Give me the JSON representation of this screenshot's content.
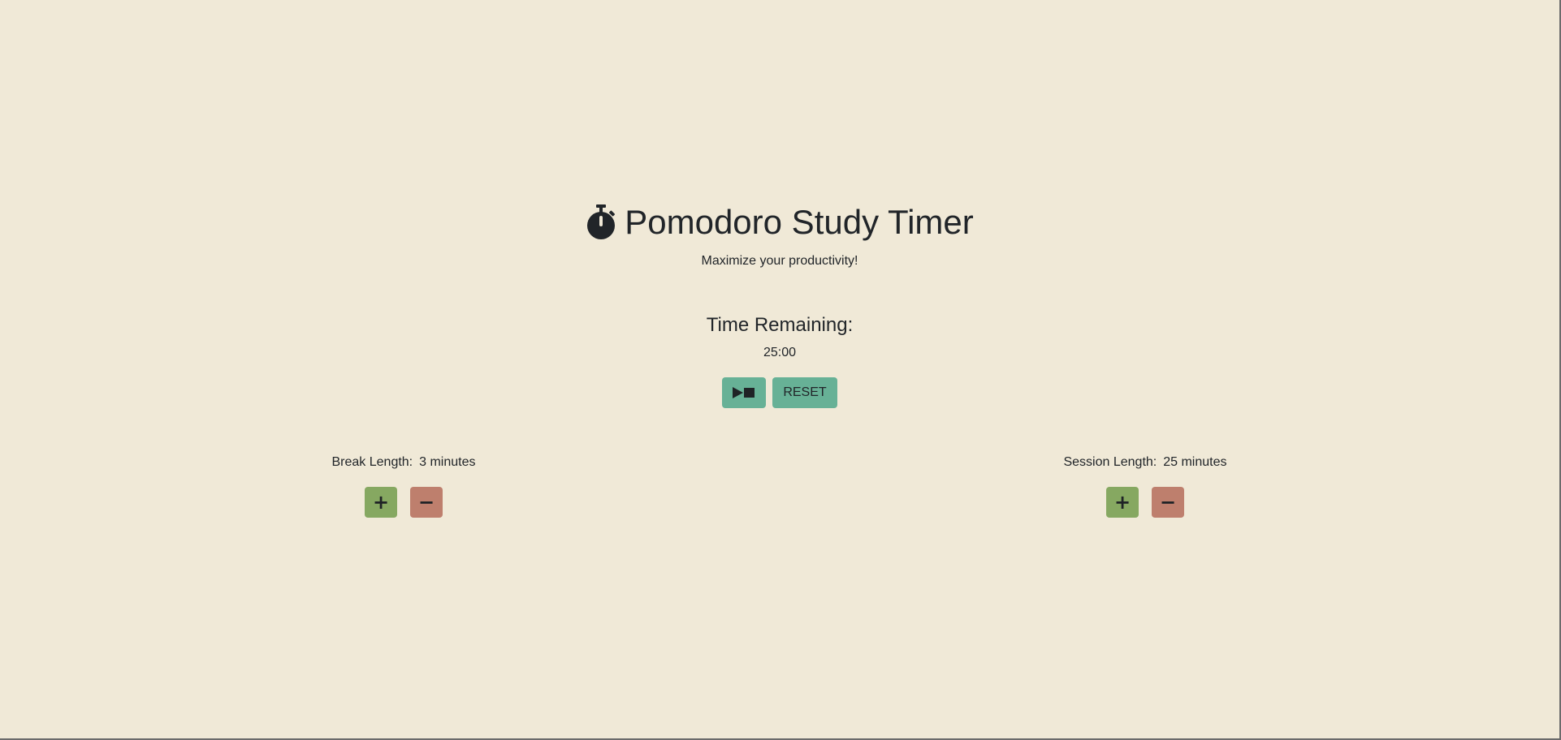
{
  "header": {
    "title": "Pomodoro Study Timer",
    "subtitle": "Maximize your productivity!",
    "icon": "stopwatch-icon"
  },
  "timer": {
    "heading": "Time Remaining:",
    "display": "25:00",
    "play_pause_icon": "play-pause-icon",
    "reset_label": "RESET"
  },
  "break": {
    "label": "Break Length:",
    "value": "3 minutes",
    "increment_symbol": "+",
    "decrement_symbol": "−"
  },
  "session": {
    "label": "Session Length:",
    "value": "25 minutes",
    "increment_symbol": "+",
    "decrement_symbol": "−"
  },
  "colors": {
    "background": "#f0e9d7",
    "teal_button": "#67b196",
    "increment_button": "#86a861",
    "decrement_button": "#be7f6d",
    "text": "#212529"
  }
}
